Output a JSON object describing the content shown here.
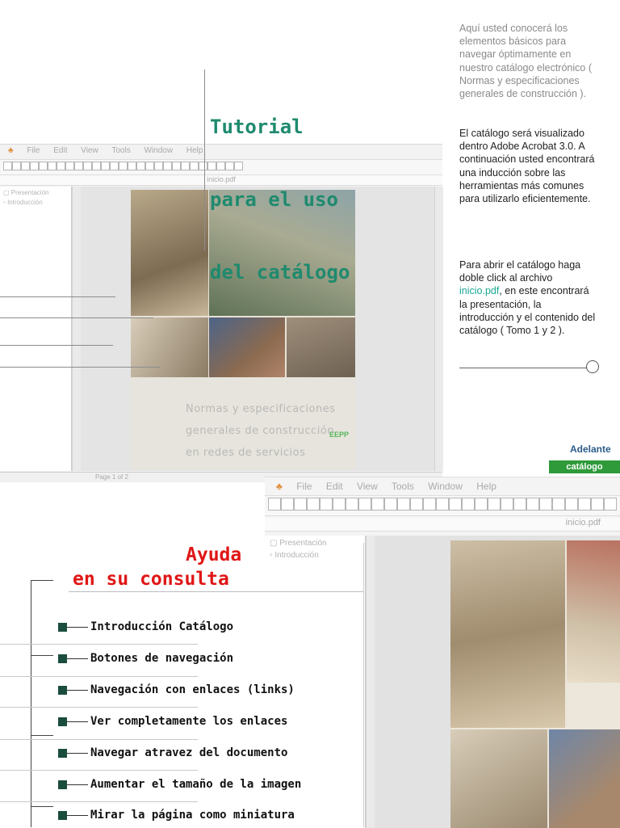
{
  "tutorial": {
    "line1": "Tutorial",
    "line2": "para el uso",
    "line3": "del catálogo"
  },
  "intro": {
    "para1": "Aquí usted conocerá los elementos básicos para navegar óptimamente en nuestro catálogo electrónico ( Normas y especificaciones generales de construcción ).",
    "para2": "El catálogo será visualizado dentro Adobe Acrobat 3.0. A continuación usted encontrará una inducción sobre las herramientas más comunes para utilizarlo eficientemente.",
    "para3_before": "Para abrir el catálogo haga doble click al archivo ",
    "para3_link": "inicio.pdf",
    "para3_after": ", en este encontrará la presentación, la introducción y el contenido del catálogo ( Tomo 1 y 2 )."
  },
  "acrobat": {
    "menu": [
      "File",
      "Edit",
      "View",
      "Tools",
      "Window",
      "Help"
    ],
    "doc_title": "inicio.pdf",
    "bookmarks": [
      "Presentación",
      "Introducción"
    ],
    "status": "Page 1 of 2",
    "cover_lines": [
      "Normas y especificaciones",
      "generales de construcción",
      "en redes de servicios"
    ]
  },
  "nav": {
    "next": "Adelante",
    "catalog": "catálogo"
  },
  "help": {
    "title_line1": "Ayuda",
    "title_line2": "en su consulta",
    "items": [
      "Introducción Catálogo",
      "Botones de navegación",
      "Navegación con enlaces (links)",
      "Ver completamente los enlaces",
      "Navegar atravez del documento",
      "Aumentar el tamaño de la imagen",
      "Mirar la página como miniatura"
    ]
  },
  "colors": {
    "title_green": "#1f8a6e",
    "help_red": "#e01616",
    "catalog_green": "#2e9a3a",
    "link_teal": "#1aa894"
  }
}
